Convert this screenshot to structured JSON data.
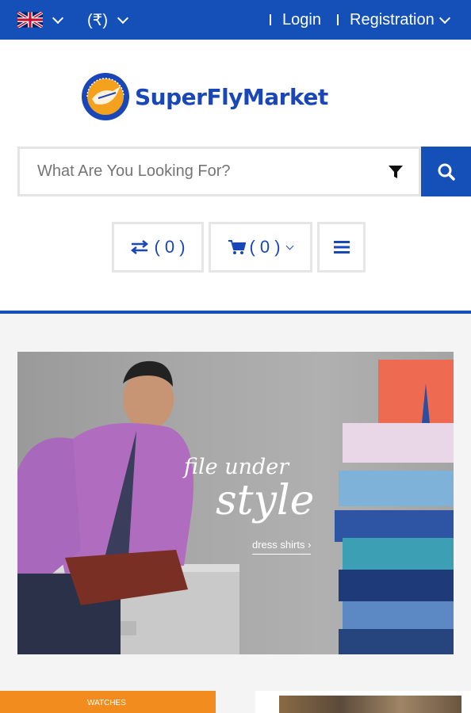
{
  "topbar": {
    "language_icon": "uk-flag-icon",
    "currency": "(₹)",
    "login": "Login",
    "registration": "Registration"
  },
  "logo": {
    "text": "SuperFlyMarket"
  },
  "search": {
    "placeholder": "What Are You Looking For?",
    "filter_icon": "filter-icon",
    "search_icon": "search-icon"
  },
  "actions": {
    "compare_count": "( 0 )",
    "cart_count": "( 0 )",
    "menu_icon": "menu-icon"
  },
  "banner": {
    "headline": "file under",
    "headline_big": "style",
    "link": "dress shirts ›"
  },
  "promo": {
    "label": "WATCHES"
  },
  "colors": {
    "primary": "#1450b8",
    "accent": "#f28c1e"
  }
}
